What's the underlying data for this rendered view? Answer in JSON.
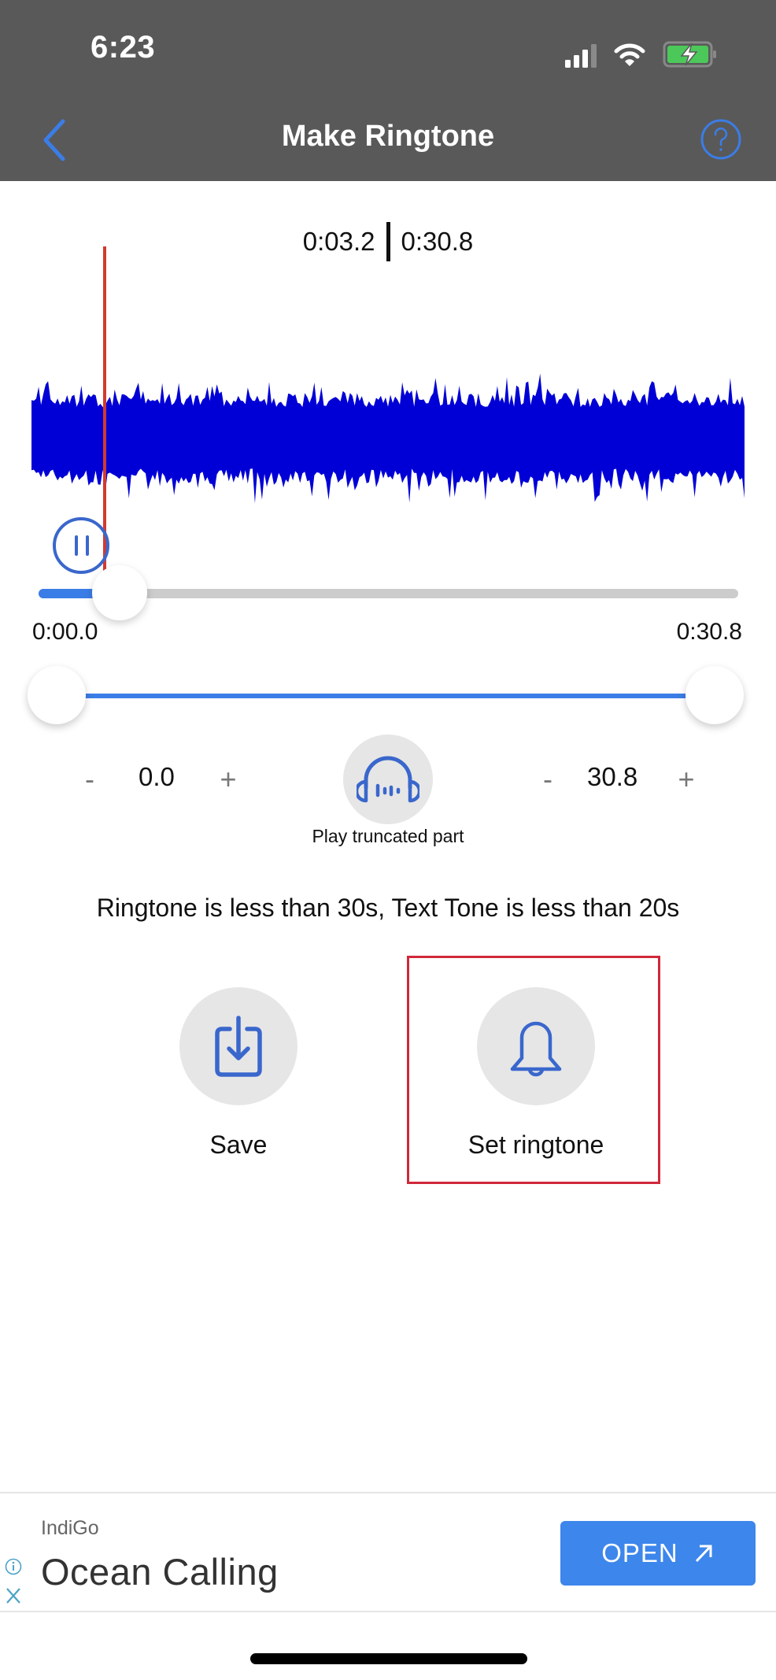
{
  "status_bar": {
    "time": "6:23",
    "signal_bars_active": 3,
    "signal_bars_total": 4,
    "battery_charging": true,
    "battery_color": "#4cc85a"
  },
  "nav": {
    "title": "Make Ringtone",
    "back_icon": "chevron-left-icon",
    "help_icon": "question-circle-icon",
    "accent_color": "#3b7de6"
  },
  "readout": {
    "current": "0:03.2",
    "total": "0:30.8"
  },
  "waveform": {
    "color": "#0000d6",
    "playhead_color": "#d23b2f",
    "playhead_position_fraction": 0.1
  },
  "player": {
    "state": "playing",
    "progress_fraction": 0.1,
    "start_label": "0:00.0",
    "end_label": "0:30.8"
  },
  "trim": {
    "start_fraction": 0.0,
    "end_fraction": 1.0,
    "start_value": "0.0",
    "end_value": "30.8",
    "minus_label": "-",
    "plus_label": "+"
  },
  "play_truncated": {
    "label": "Play truncated part",
    "icon": "headphones-icon"
  },
  "info_text": "Ringtone is less than 30s, Text Tone is less than 20s",
  "actions": [
    {
      "label": "Save",
      "icon": "download-icon"
    },
    {
      "label": "Set ringtone",
      "icon": "bell-icon",
      "highlighted": true
    }
  ],
  "ad": {
    "brand": "IndiGo",
    "title": "Ocean Calling",
    "button_label": "OPEN",
    "button_color": "#3d86ec"
  }
}
